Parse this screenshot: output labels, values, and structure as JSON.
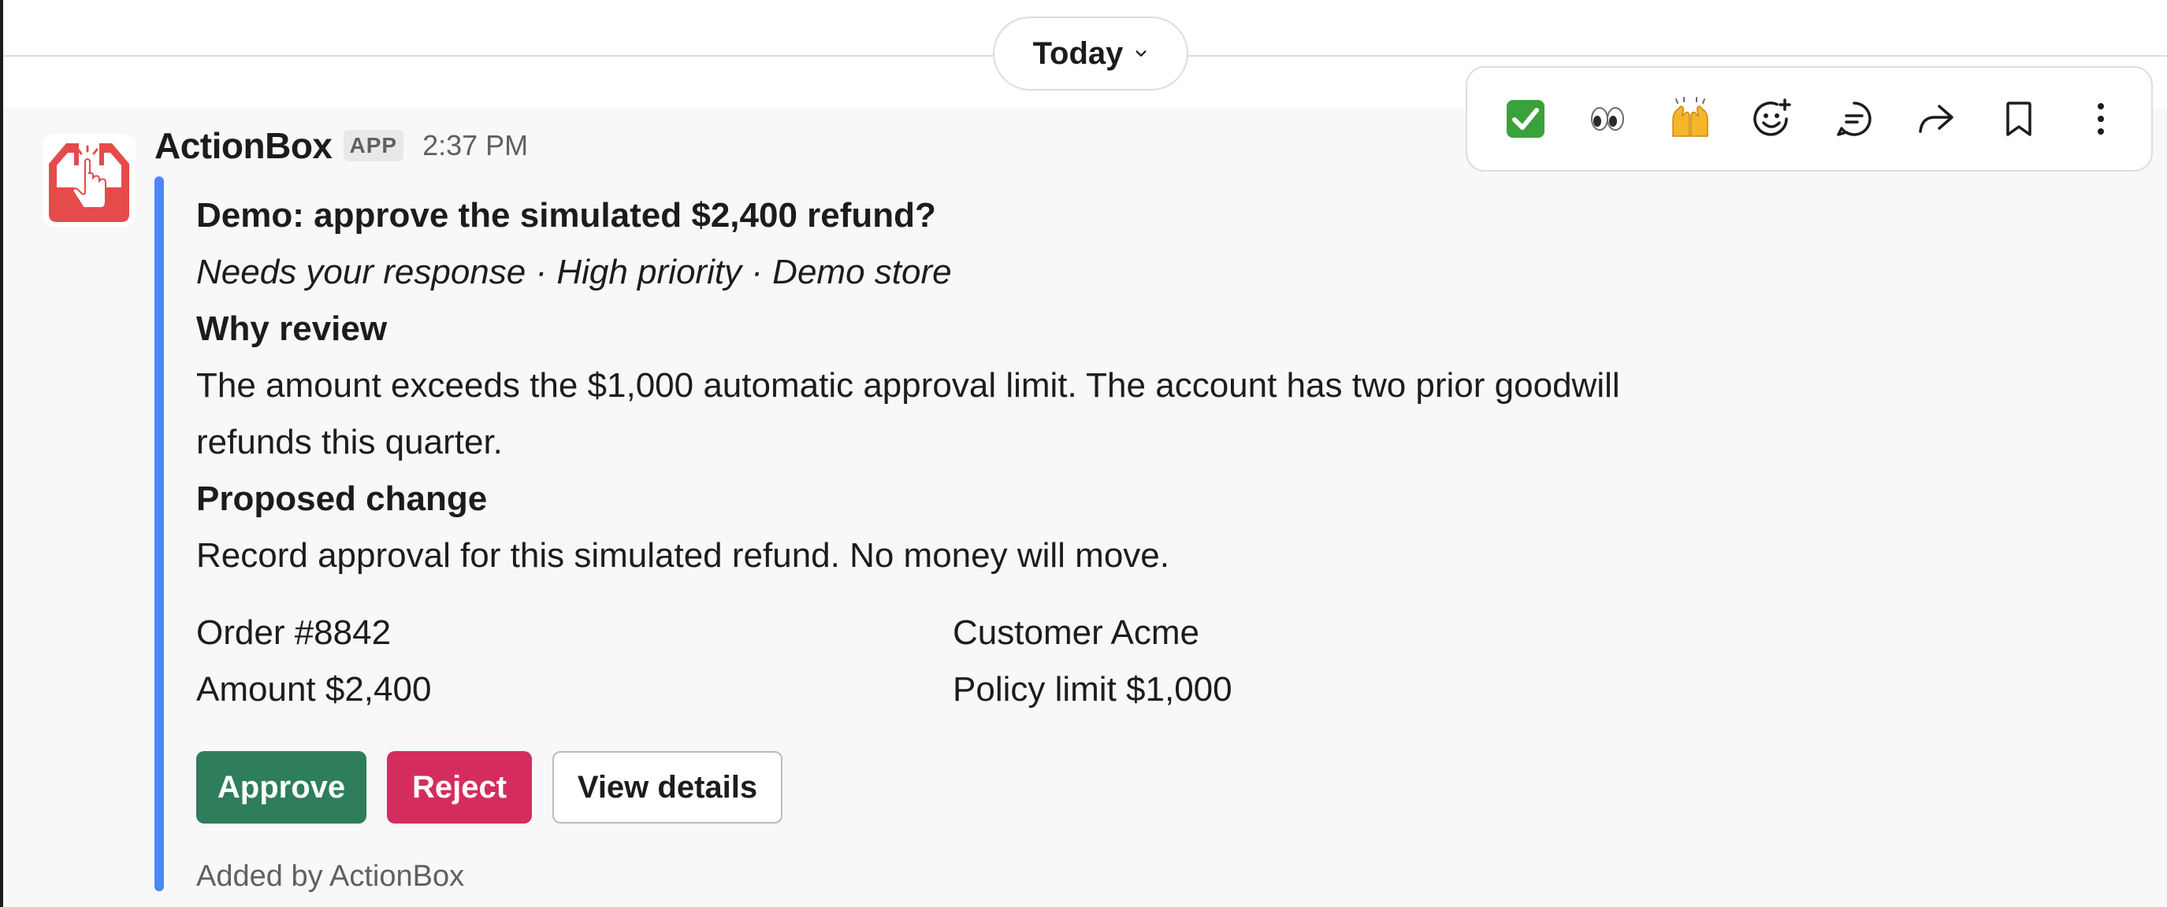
{
  "date_divider": {
    "label": "Today"
  },
  "message": {
    "sender": "ActionBox",
    "badge": "APP",
    "timestamp": "2:37 PM",
    "title": "Demo: approve the simulated $2,400 refund?",
    "meta": "Needs your response · High priority · Demo store",
    "sections": [
      {
        "heading": "Why review",
        "text": "The amount exceeds the $1,000 automatic approval limit. The account has two prior goodwill refunds this quarter."
      },
      {
        "heading": "Proposed change",
        "text": "Record approval for this simulated refund. No money will move."
      }
    ],
    "fields": [
      "Order #8842",
      "Customer Acme",
      "Amount $2,400",
      "Policy limit $1,000"
    ],
    "buttons": {
      "approve": "Approve",
      "reject": "Reject",
      "details": "View details"
    },
    "footer": "Added by ActionBox"
  },
  "toolbar": [
    {
      "name": "white-check-mark-reaction",
      "icon": "check-mark-emoji-icon"
    },
    {
      "name": "eyes-reaction",
      "icon": "eyes-emoji-icon"
    },
    {
      "name": "raised-hands-reaction",
      "icon": "raised-hands-emoji-icon"
    },
    {
      "name": "add-reaction",
      "icon": "add-emoji-icon"
    },
    {
      "name": "reply-in-thread",
      "icon": "thread-bubble-icon"
    },
    {
      "name": "share-message",
      "icon": "forward-arrow-icon"
    },
    {
      "name": "save-for-later",
      "icon": "bookmark-icon"
    },
    {
      "name": "more-actions",
      "icon": "vertical-ellipsis-icon"
    }
  ],
  "colors": {
    "accent_bar": "#4f86f7",
    "approve": "#2e7d5b",
    "reject": "#d42d5d",
    "logo": "#e54b4b"
  }
}
